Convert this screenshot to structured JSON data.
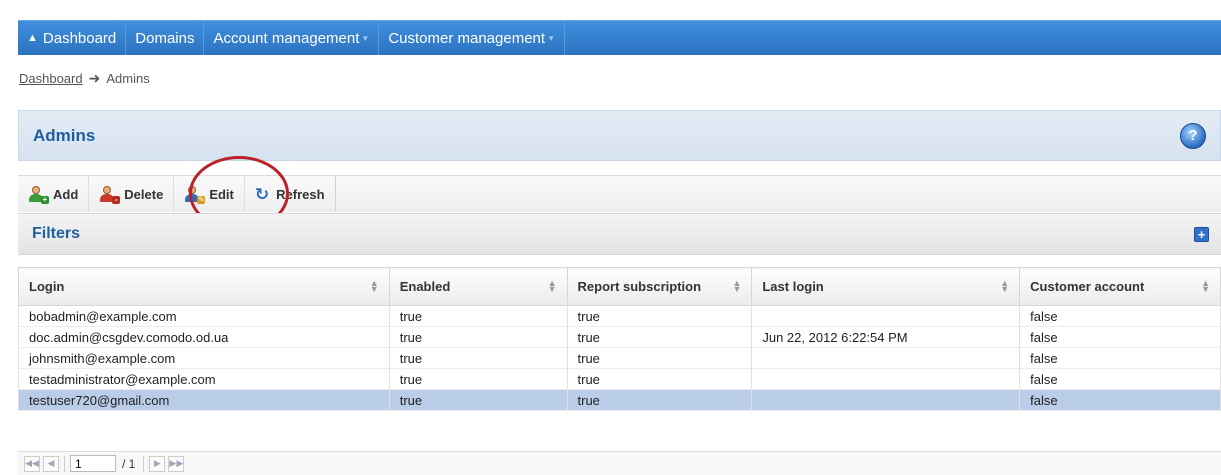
{
  "nav": {
    "items": [
      {
        "label": "Dashboard",
        "has_home_icon": true,
        "has_dropdown": false
      },
      {
        "label": "Domains",
        "has_dropdown": false
      },
      {
        "label": "Account management",
        "has_dropdown": true
      },
      {
        "label": "Customer management",
        "has_dropdown": true
      }
    ]
  },
  "breadcrumb": {
    "root": "Dashboard",
    "current": "Admins"
  },
  "page": {
    "title": "Admins",
    "help_icon": "help-icon"
  },
  "toolbar": {
    "add_label": "Add",
    "delete_label": "Delete",
    "edit_label": "Edit",
    "refresh_label": "Refresh"
  },
  "filters": {
    "title": "Filters",
    "expand_symbol": "+"
  },
  "table": {
    "columns": [
      "Login",
      "Enabled",
      "Report subscription",
      "Last login",
      "Customer account"
    ],
    "rows": [
      {
        "login": "bobadmin@example.com",
        "enabled": "true",
        "report": "true",
        "last_login": "",
        "customer": "false"
      },
      {
        "login": "doc.admin@csgdev.comodo.od.ua",
        "enabled": "true",
        "report": "true",
        "last_login": "Jun 22, 2012 6:22:54 PM",
        "customer": "false"
      },
      {
        "login": "johnsmith@example.com",
        "enabled": "true",
        "report": "true",
        "last_login": "",
        "customer": "false"
      },
      {
        "login": "testadministrator@example.com",
        "enabled": "true",
        "report": "true",
        "last_login": "",
        "customer": "false"
      },
      {
        "login": "testuser720@gmail.com",
        "enabled": "true",
        "report": "true",
        "last_login": "",
        "customer": "false",
        "selected": true
      }
    ]
  },
  "pager": {
    "page_value": "1",
    "total": "/ 1"
  },
  "colors": {
    "nav": "#2d73c2",
    "title": "#1f5f9e",
    "selected_row": "#b9cde9",
    "highlight": "#b8222a"
  }
}
